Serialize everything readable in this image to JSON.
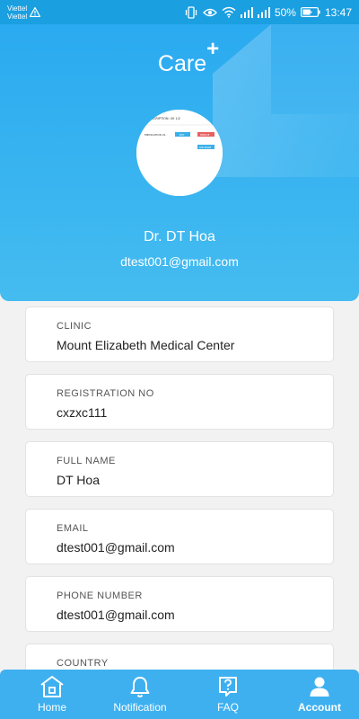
{
  "status_bar": {
    "carrier_1": "Viettel",
    "carrier_2": "Viettel",
    "battery": "50%",
    "time": "13:47"
  },
  "header": {
    "logo_text": "Care",
    "logo_plus": "+",
    "doctor_name": "Dr. DT Hoa",
    "doctor_email": "dtest001@gmail.com",
    "avatar_preview": {
      "title": "PRESCRIPTION: 00 1/2",
      "medication": "MEDICATION 01",
      "edit_label": "EDIT",
      "remove_label": "REMOVE",
      "add_label": "ADD MORE"
    }
  },
  "info": [
    {
      "label": "CLINIC",
      "value": "Mount Elizabeth Medical Center"
    },
    {
      "label": "REGISTRATION NO",
      "value": "cxzxc111"
    },
    {
      "label": "FULL NAME",
      "value": "DT Hoa"
    },
    {
      "label": "EMAIL",
      "value": "dtest001@gmail.com"
    },
    {
      "label": "PHONE NUMBER",
      "value": "dtest001@gmail.com"
    },
    {
      "label": "COUNTRY",
      "value": ""
    }
  ],
  "nav": {
    "home": "Home",
    "notification": "Notification",
    "faq": "FAQ",
    "account": "Account",
    "active": "account"
  },
  "colors": {
    "header_top": "#2aaaf0",
    "header_bottom": "#45bcf0",
    "nav_background": "#3eb0f0",
    "status_bar": "#1a9fe0",
    "page_background": "#f2f2f2"
  }
}
